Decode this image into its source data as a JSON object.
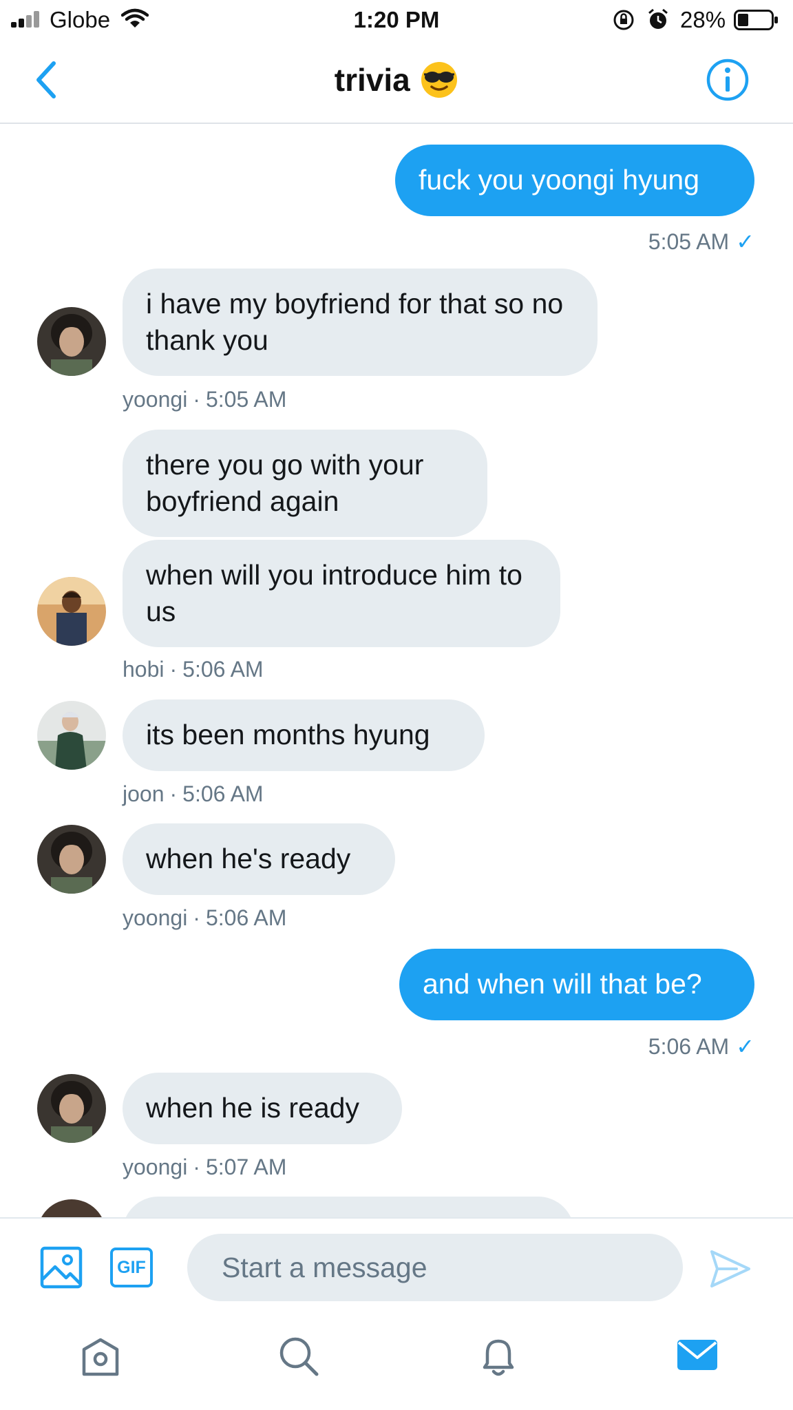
{
  "status_bar": {
    "carrier": "Globe",
    "time": "1:20 PM",
    "battery": "28%"
  },
  "header": {
    "title": "trivia",
    "title_emoji": "smiling-face-with-sunglasses-emoji",
    "back_icon": "chevron-left-icon",
    "info_icon": "info-icon"
  },
  "messages": [
    {
      "direction": "out",
      "text": "fuck you yoongi hyung",
      "time": "5:05 AM"
    },
    {
      "direction": "in",
      "sender": "yoongi",
      "text": "i have my boyfriend for that so no thank you",
      "time": "5:05 AM"
    },
    {
      "direction": "in",
      "sender": "hobi",
      "text": "there you go with your boyfriend again"
    },
    {
      "direction": "in",
      "sender": "hobi",
      "text": "when will you introduce him to us",
      "time": "5:06 AM"
    },
    {
      "direction": "in",
      "sender": "joon",
      "text": "its been months hyung",
      "time": "5:06 AM"
    },
    {
      "direction": "in",
      "sender": "yoongi",
      "text": "when he's ready",
      "time": "5:06 AM"
    },
    {
      "direction": "out",
      "text": "and when will that be?",
      "time": "5:06 AM"
    },
    {
      "direction": "in",
      "sender": "yoongi",
      "text": "when he is ready",
      "time": "5:07 AM"
    }
  ],
  "meta_separator": "·",
  "read_receipt": "✓",
  "composer": {
    "placeholder": "Start a message",
    "gif_label": "GIF"
  },
  "tabs": [
    {
      "icon": "home-icon"
    },
    {
      "icon": "search-icon"
    },
    {
      "icon": "bell-icon"
    },
    {
      "icon": "mail-icon",
      "active": true
    }
  ],
  "colors": {
    "accent": "#1da1f2",
    "incoming_bubble": "#e6ecf0",
    "meta_text": "#657786"
  }
}
